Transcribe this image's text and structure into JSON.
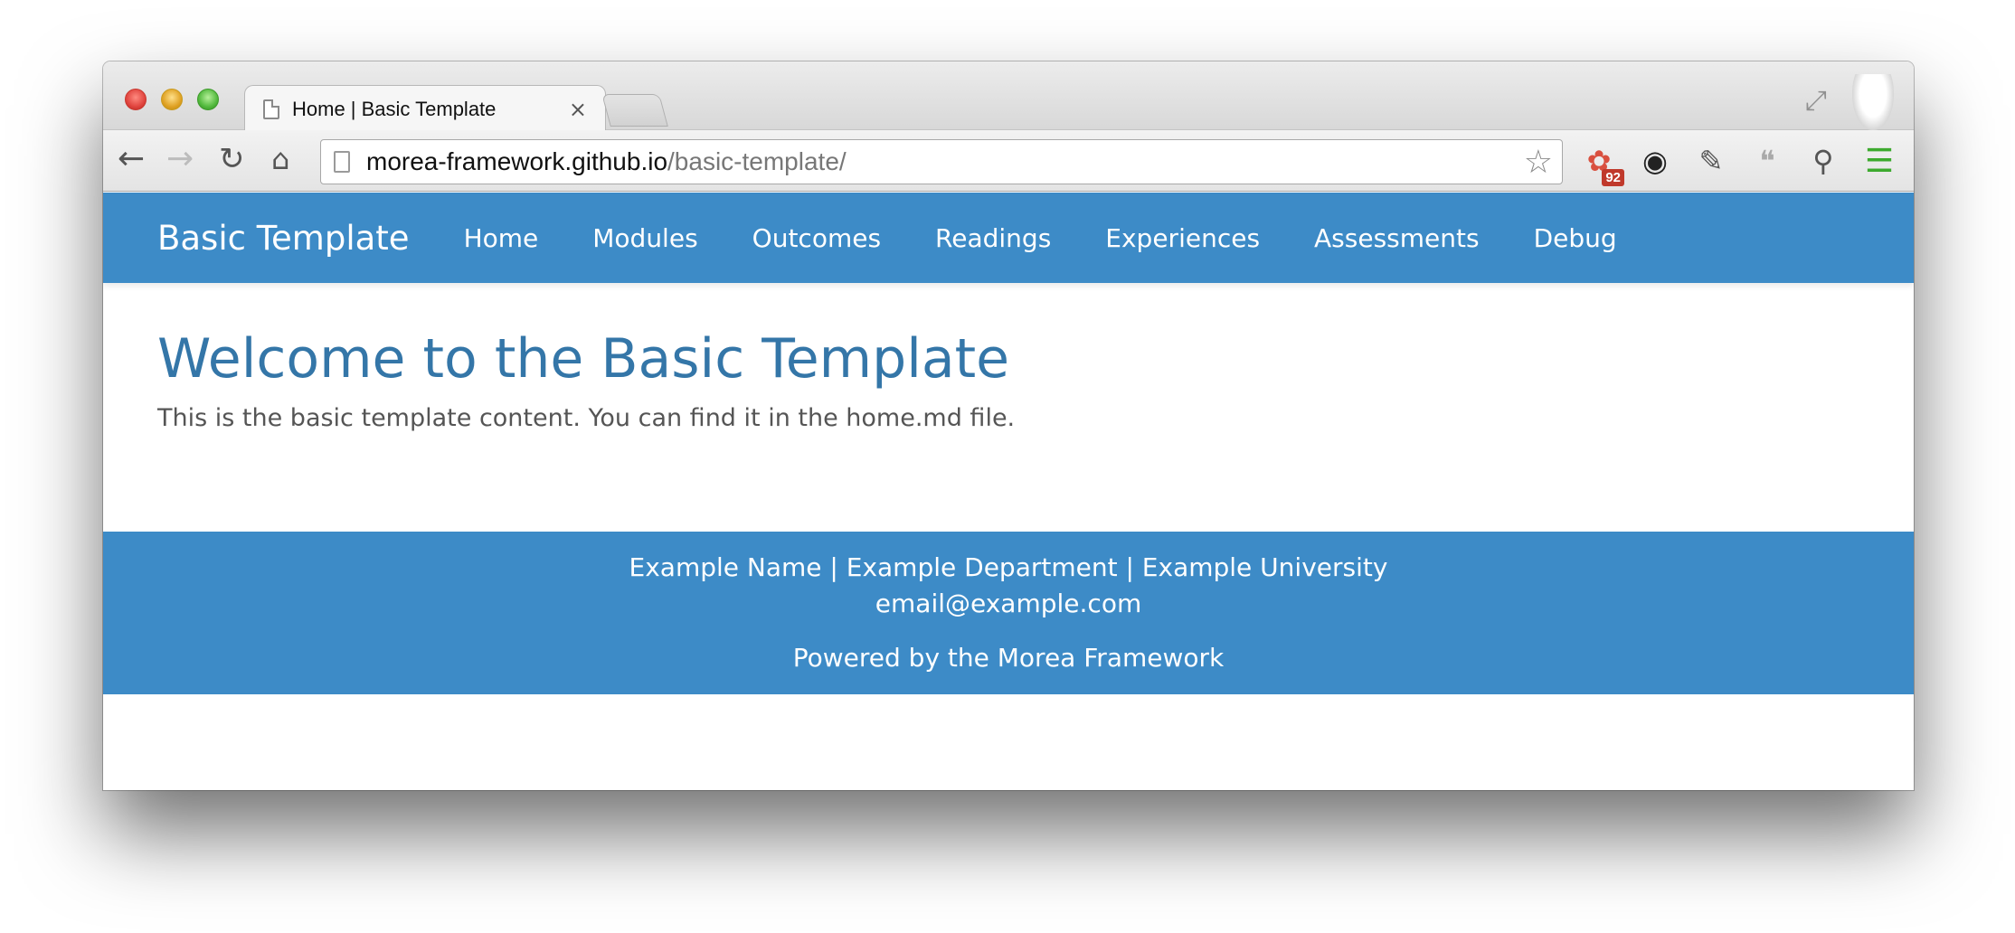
{
  "browser": {
    "tab_title": "Home | Basic Template",
    "tab_close": "×",
    "url_host": "morea-framework.github.io",
    "url_path": "/basic-template/",
    "extensions": [
      {
        "name": "extension-1-icon",
        "badge": "92"
      },
      {
        "name": "extension-2-icon"
      },
      {
        "name": "eyedropper-icon"
      },
      {
        "name": "quote-icon"
      },
      {
        "name": "wrench-icon"
      },
      {
        "name": "menu-icon"
      }
    ],
    "colors": {
      "navbar": "#3d8bc7",
      "title": "#3476a8",
      "menu_icon": "#3daa2e"
    }
  },
  "nav": {
    "brand": "Basic Template",
    "items": [
      "Home",
      "Modules",
      "Outcomes",
      "Readings",
      "Experiences",
      "Assessments",
      "Debug"
    ]
  },
  "main": {
    "title": "Welcome to the Basic Template",
    "body": "This is the basic template content. You can find it in the home.md file."
  },
  "footer": {
    "line1": "Example Name | Example Department | Example University",
    "line2": "email@example.com",
    "line3": "Powered by the Morea Framework"
  }
}
